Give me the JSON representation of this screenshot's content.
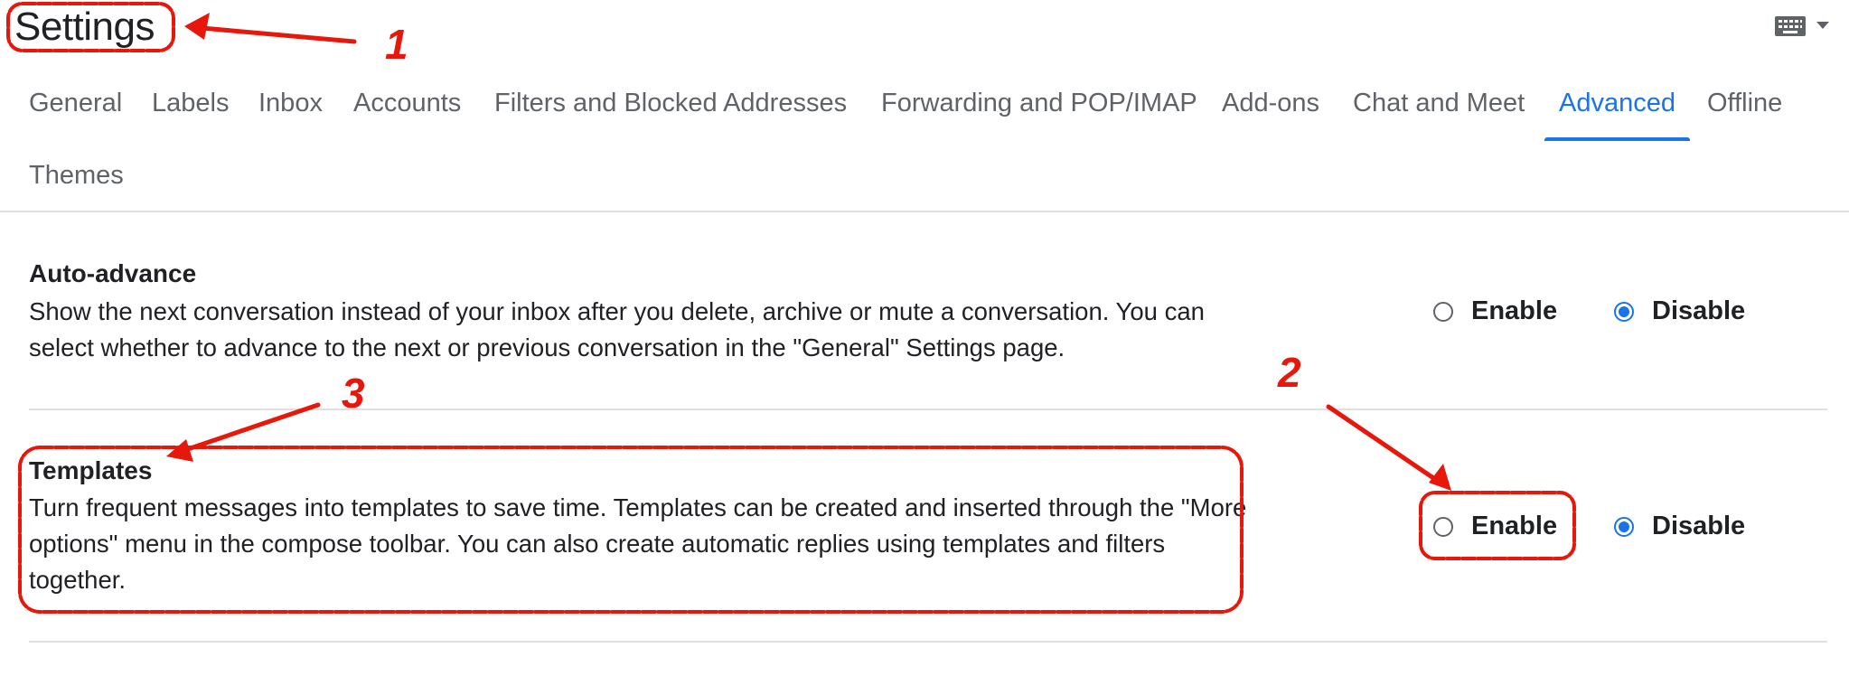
{
  "header": {
    "title": "Settings"
  },
  "icons": {
    "keyboard": "keyboard-icon",
    "dropdown": "caret-down-icon"
  },
  "colors": {
    "accent": "#1a73e8",
    "annotation": "#e8170c",
    "text": "#202124",
    "muted": "#5f6368"
  },
  "tabs": [
    {
      "label": "General"
    },
    {
      "label": "Labels"
    },
    {
      "label": "Inbox"
    },
    {
      "label": "Accounts"
    },
    {
      "label": "Filters and Blocked Addresses"
    },
    {
      "label": "Forwarding and POP/IMAP"
    },
    {
      "label": "Add-ons"
    },
    {
      "label": "Chat and Meet"
    },
    {
      "label": "Advanced",
      "active": true
    },
    {
      "label": "Offline"
    },
    {
      "label": "Themes"
    }
  ],
  "sections": {
    "auto_advance": {
      "title": "Auto-advance",
      "description": "Show the next conversation instead of your inbox after you delete, archive or mute a conversation. You can select whether to advance to the next or previous conversation in the \"General\" Settings page.",
      "enable_label": "Enable",
      "disable_label": "Disable",
      "selected": "Disable"
    },
    "templates": {
      "title": "Templates",
      "description": "Turn frequent messages into templates to save time. Templates can be created and inserted through the \"More options\" menu in the compose toolbar. You can also create automatic replies using templates and filters together.",
      "enable_label": "Enable",
      "disable_label": "Disable",
      "selected": "Disable"
    }
  },
  "annotations": {
    "one": "1",
    "two": "2",
    "three": "3"
  }
}
